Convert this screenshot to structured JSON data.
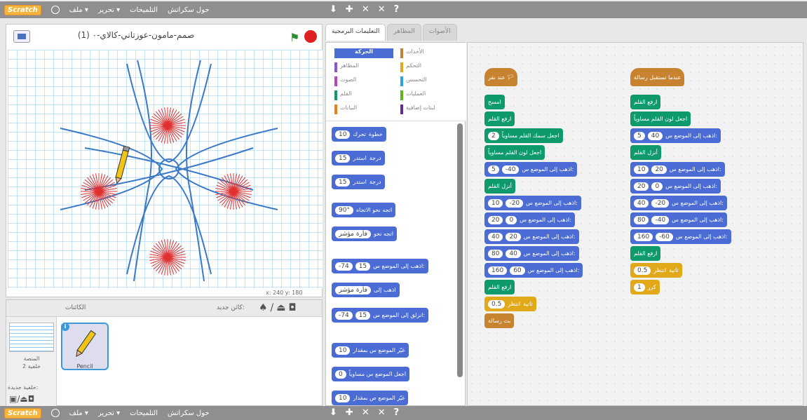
{
  "menubar": {
    "logo": "Scratch",
    "items": [
      "حول سكراتش",
      "التلميحات",
      "تحرير ▾",
      "ملف ▾"
    ],
    "tools": [
      "⬇",
      "✚",
      "✕",
      "✕",
      "?"
    ]
  },
  "stage": {
    "title": "(1) صمم-مامون-عوزتاني-كالاي-٠",
    "coords": "x: 240  y: 180"
  },
  "sprites": {
    "header": "الكائنات",
    "new_sprite": "كائن جديد:",
    "stage_label": "المنصة\nخلفية 2",
    "new_bg": "خلفية جديدة:",
    "sprite_name": "Pencil"
  },
  "tabs": [
    "التعليمات البرمجية",
    "المظاهر",
    "الأصوات"
  ],
  "categories": [
    {
      "label": "الأحداث",
      "color": "#c88330"
    },
    {
      "label": "الحركة",
      "color": "#4a6cd4",
      "selected": true
    },
    {
      "label": "التحكم",
      "color": "#e1a91a"
    },
    {
      "label": "المظاهر",
      "color": "#8a55d7"
    },
    {
      "label": "التحسس",
      "color": "#2ca5e2"
    },
    {
      "label": "الصوت",
      "color": "#bb42c3"
    },
    {
      "label": "العمليات",
      "color": "#5cb712"
    },
    {
      "label": "القلم",
      "color": "#0e9a6c"
    },
    {
      "label": "لبنات إضافية",
      "color": "#632d99"
    },
    {
      "label": "البيانات",
      "color": "#ee7d16"
    }
  ],
  "palette_blocks": [
    {
      "label": "تحرك",
      "num": "10",
      "suffix": "خطوة"
    },
    {
      "label": "استدر",
      "num": "15",
      "suffix": "درجة"
    },
    {
      "label": "استدر",
      "num": "15",
      "suffix": "درجة"
    },
    {
      "label": "اتجه نحو الاتجاه",
      "num": "90°"
    },
    {
      "label": "اتجه نحو",
      "num": "فأرة مؤشر"
    },
    {
      "label": "اذهب إلى الموضع س:",
      "num": "15",
      "num2": "-74"
    },
    {
      "label": "اذهب إلى",
      "num": "فأرة مؤشر"
    },
    {
      "label": "انزلق إلى الموضع س:",
      "num": "15",
      "num2": "-74"
    },
    {
      "label": "غيّر الموضع س بمقدار",
      "num": "10"
    },
    {
      "label": "اجعل الموضع س مساوياً",
      "num": "0"
    },
    {
      "label": "غيّر الموضع ص بمقدار",
      "num": "10"
    }
  ],
  "script1": [
    {
      "type": "events",
      "hat": true,
      "label": "عند نقر 🏳"
    },
    {
      "type": "pen",
      "label": "امسح"
    },
    {
      "type": "pen",
      "label": "ارفع القلم"
    },
    {
      "type": "pen",
      "label": "اجعل سمك القلم مساوياً",
      "num": "2"
    },
    {
      "type": "pen",
      "label": "اجعل لون القلم مساوياً"
    },
    {
      "type": "motion",
      "label": "اذهب إلى الموضع س:",
      "num": "-40",
      "num2": "5"
    },
    {
      "type": "pen",
      "label": "أنزل القلم"
    },
    {
      "type": "motion",
      "label": "اذهب إلى الموضع س:",
      "num": "-20",
      "num2": "10"
    },
    {
      "type": "motion",
      "label": "اذهب إلى الموضع س:",
      "num": "0",
      "num2": "20"
    },
    {
      "type": "motion",
      "label": "اذهب إلى الموضع س:",
      "num": "20",
      "num2": "40"
    },
    {
      "type": "motion",
      "label": "اذهب إلى الموضع س:",
      "num": "40",
      "num2": "80"
    },
    {
      "type": "motion",
      "label": "اذهب إلى الموضع س:",
      "num": "60",
      "num2": "160"
    },
    {
      "type": "pen",
      "label": "ارفع القلم"
    },
    {
      "type": "control",
      "label": "انتظر",
      "num": "0.5",
      "suffix": "ثانية"
    },
    {
      "type": "events",
      "label": "بث رسالة"
    }
  ],
  "script2": [
    {
      "type": "events",
      "hat": true,
      "label": "عندما تستقبل رسالة"
    },
    {
      "type": "pen",
      "label": "ارفع القلم"
    },
    {
      "type": "pen",
      "label": "اجعل لون القلم مساوياً"
    },
    {
      "type": "motion",
      "label": "اذهب إلى الموضع س:",
      "num": "40",
      "num2": "5"
    },
    {
      "type": "pen",
      "label": "أنزل القلم"
    },
    {
      "type": "motion",
      "label": "اذهب إلى الموضع س:",
      "num": "20",
      "num2": "10"
    },
    {
      "type": "motion",
      "label": "اذهب إلى الموضع س:",
      "num": "0",
      "num2": "20"
    },
    {
      "type": "motion",
      "label": "اذهب إلى الموضع س:",
      "num": "-20",
      "num2": "40"
    },
    {
      "type": "motion",
      "label": "اذهب إلى الموضع س:",
      "num": "-40",
      "num2": "80"
    },
    {
      "type": "motion",
      "label": "اذهب إلى الموضع س:",
      "num": "-60",
      "num2": "160"
    },
    {
      "type": "pen",
      "label": "ارفع القلم"
    },
    {
      "type": "control",
      "label": "انتظر",
      "num": "0.5",
      "suffix": "ثانية"
    },
    {
      "type": "control",
      "label": "كرر",
      "num": "1"
    }
  ]
}
